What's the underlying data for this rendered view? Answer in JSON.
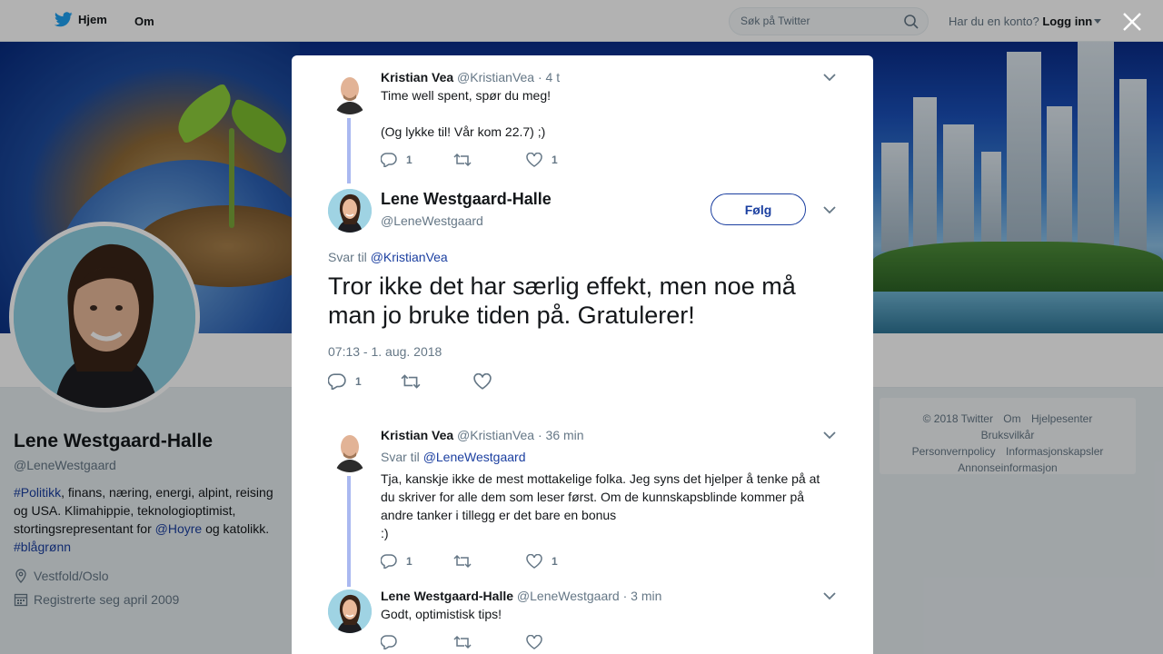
{
  "topbar": {
    "home_label": "Hjem",
    "about_label": "Om",
    "search_placeholder": "Søk på Twitter",
    "account_question": "Har du en konto?",
    "login_label": "Logg inn"
  },
  "profile": {
    "name": "Lene Westgaard-Halle",
    "handle": "@LeneWestgaard",
    "bio_parts": {
      "tag1": "#Politikk",
      "text1": ", finans, næring, energi, alpint, reising og USA. Klimahippie, teknologioptimist, stortingsrepresentant for ",
      "mention": "@Hoyre",
      "text2": " og katolikk. ",
      "tag2": "#blågrønn"
    },
    "location": "Vestfold/Oslo",
    "joined": "Registrerte seg april 2009"
  },
  "footer": {
    "items": [
      "© 2018 Twitter",
      "Om",
      "Hjelpesenter",
      "Bruksvilkår",
      "Personvernpolicy",
      "Informasjonskapsler",
      "Annonseinformasjon"
    ]
  },
  "modal": {
    "tweet1": {
      "name": "Kristian Vea",
      "handle": "@KristianVea",
      "time": "· 4 t",
      "line1": "Time well spent, spør du meg!",
      "line2": "(Og lykke til! Vår kom 22.7) ;)",
      "replies": "1",
      "retweets": "",
      "likes": "1"
    },
    "main": {
      "name": "Lene Westgaard-Halle",
      "handle": "@LeneWestgaard",
      "follow_label": "Følg",
      "reply_to_prefix": "Svar til",
      "reply_to_handle": "@KristianVea",
      "text": "Tror ikke det har særlig effekt, men noe må man jo bruke tiden på. Gratulerer!",
      "timestamp": "07:13 - 1. aug. 2018",
      "replies": "1",
      "retweets": "",
      "likes": ""
    },
    "tweet2": {
      "name": "Kristian Vea",
      "handle": "@KristianVea",
      "time": "· 36 min",
      "reply_to_prefix": "Svar til",
      "reply_to_handle": "@LeneWestgaard",
      "text": "Tja, kanskje ikke de mest mottakelige folka. Jeg syns det hjelper å tenke på at du skriver for alle dem som leser først. Om de kunnskapsblinde kommer på andre tanker i tillegg er det bare en bonus",
      "text2": ":)",
      "replies": "1",
      "retweets": "",
      "likes": "1"
    },
    "tweet3": {
      "name": "Lene Westgaard-Halle",
      "handle": "@LeneWestgaard",
      "time": "· 3 min",
      "text": "Godt, optimistisk tips!"
    }
  },
  "colors": {
    "link": "#1b3fa0",
    "muted": "#657786",
    "thread": "#aab8f0"
  }
}
